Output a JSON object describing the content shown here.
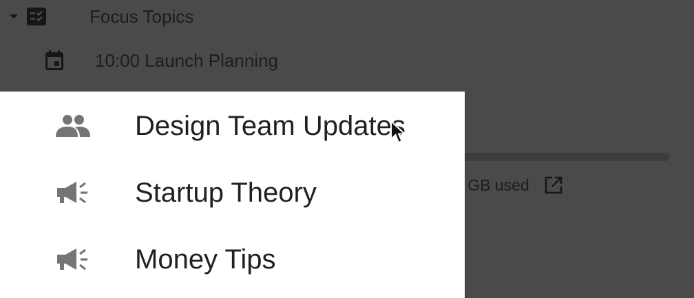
{
  "background": {
    "tree": [
      {
        "label": "Focus Topics",
        "icon": "checklist-icon",
        "expanded": true
      },
      {
        "label": "10:00 Launch Planning",
        "icon": "calendar-event-icon"
      }
    ],
    "storage": {
      "text": "0 GB used",
      "icon": "open-in-new-icon"
    }
  },
  "menu": {
    "items": [
      {
        "label": "Design Team Updates",
        "icon": "group-icon"
      },
      {
        "label": "Startup Theory",
        "icon": "announcement-icon"
      },
      {
        "label": "Money Tips",
        "icon": "announcement-icon"
      }
    ]
  },
  "colors": {
    "overlay": "#4a4a4a",
    "menu_bg": "#ffffff",
    "icon": "#757575",
    "text": "#212121"
  }
}
